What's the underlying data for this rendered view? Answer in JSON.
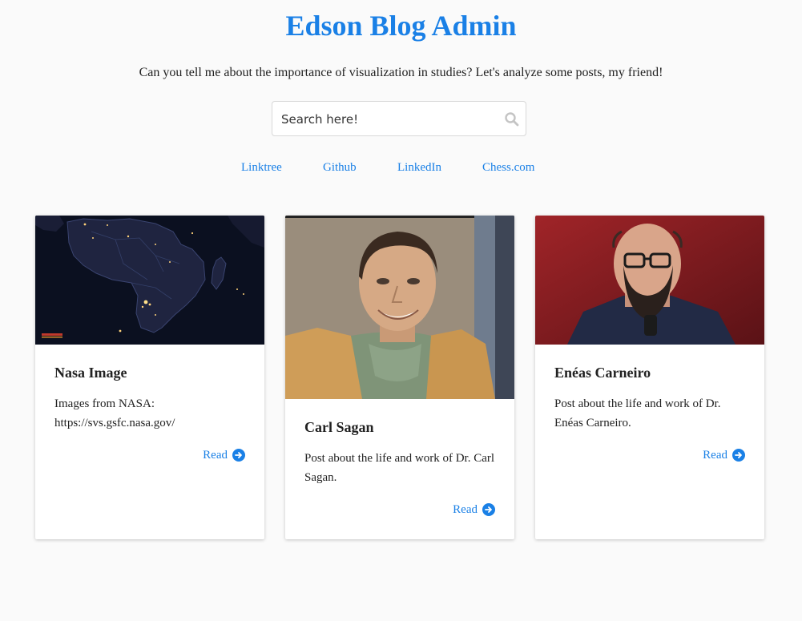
{
  "header": {
    "title": "Edson Blog Admin",
    "subtitle": "Can you tell me about the importance of visualization in studies? Let's analyze some posts, my friend!"
  },
  "search": {
    "placeholder": "Search here!",
    "icon": "search-icon"
  },
  "nav_links": [
    {
      "label": "Linktree"
    },
    {
      "label": "Github"
    },
    {
      "label": "LinkedIn"
    },
    {
      "label": "Chess.com"
    }
  ],
  "posts": [
    {
      "title": "Nasa Image",
      "description": "Images from NASA: https://svs.gsfc.nasa.gov/",
      "read_label": "Read",
      "image": "night-map-of-africa"
    },
    {
      "title": "Carl Sagan",
      "description": "Post about the life and work of Dr. Carl Sagan.",
      "read_label": "Read",
      "image": "portrait-carl-sagan"
    },
    {
      "title": "Enéas Carneiro",
      "description": "Post about the life and work of Dr. Enéas Carneiro.",
      "read_label": "Read",
      "image": "portrait-eneas-carneiro"
    }
  ],
  "colors": {
    "accent": "#1a80e6",
    "background": "#fafafa",
    "card": "#ffffff",
    "text": "#222222"
  }
}
